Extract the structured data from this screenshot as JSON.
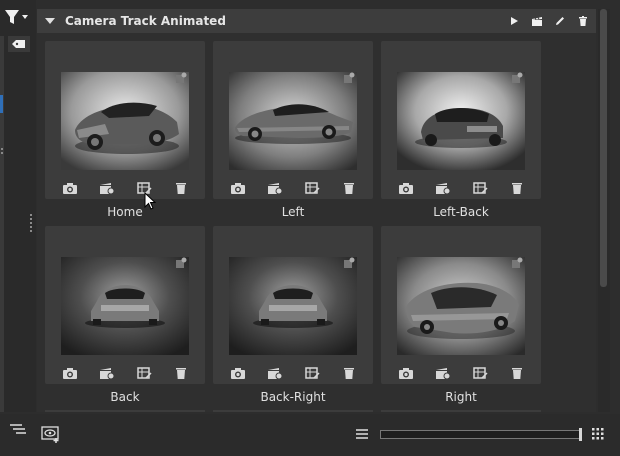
{
  "panel": {
    "title": "Camera Track Animated",
    "header_icons": [
      "play-icon",
      "clapperboard-icon",
      "pencil-icon",
      "trash-icon"
    ]
  },
  "cards": [
    {
      "label": "Home",
      "view": "front-three-quarter"
    },
    {
      "label": "Left",
      "view": "side"
    },
    {
      "label": "Left-Back",
      "view": "rear-three-quarter"
    },
    {
      "label": "Back",
      "view": "rear"
    },
    {
      "label": "Back-Right",
      "view": "rear"
    },
    {
      "label": "Right",
      "view": "top-three-quarter"
    }
  ],
  "card_tools": [
    "camera-icon",
    "record-icon",
    "frame-edit-icon",
    "trash-icon"
  ],
  "colors": {
    "accent": "#2f6fb8",
    "panel_bg": "#2f2f2f",
    "card_bg": "#3c3c3c"
  },
  "bottom_bar": {
    "icons": [
      "list-indent-icon",
      "eye-add-icon",
      "menu-icon",
      "grid-dots-icon"
    ]
  }
}
